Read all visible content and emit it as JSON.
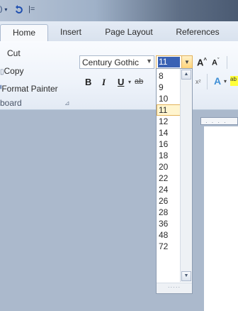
{
  "window": {
    "qat_separator": "|="
  },
  "tabs": [
    {
      "label": "Home"
    },
    {
      "label": "Insert"
    },
    {
      "label": "Page Layout"
    },
    {
      "label": "References"
    }
  ],
  "clipboard": {
    "cut_label": "Cut",
    "copy_label": "Copy",
    "format_painter_label": "Format Painter",
    "group_label": "board"
  },
  "font": {
    "name": "Century Gothic",
    "size": "11",
    "bold_label": "B",
    "italic_label": "I",
    "underline_label": "U"
  },
  "font_size_options": [
    "8",
    "9",
    "10",
    "11",
    "12",
    "14",
    "16",
    "18",
    "20",
    "22",
    "24",
    "26",
    "28",
    "36",
    "48",
    "72"
  ],
  "selected_size": "11",
  "colors": {
    "selection_highlight": "#fff5cf",
    "selection_border": "#e3b25a",
    "size_text_highlight": "#3a62b4"
  }
}
